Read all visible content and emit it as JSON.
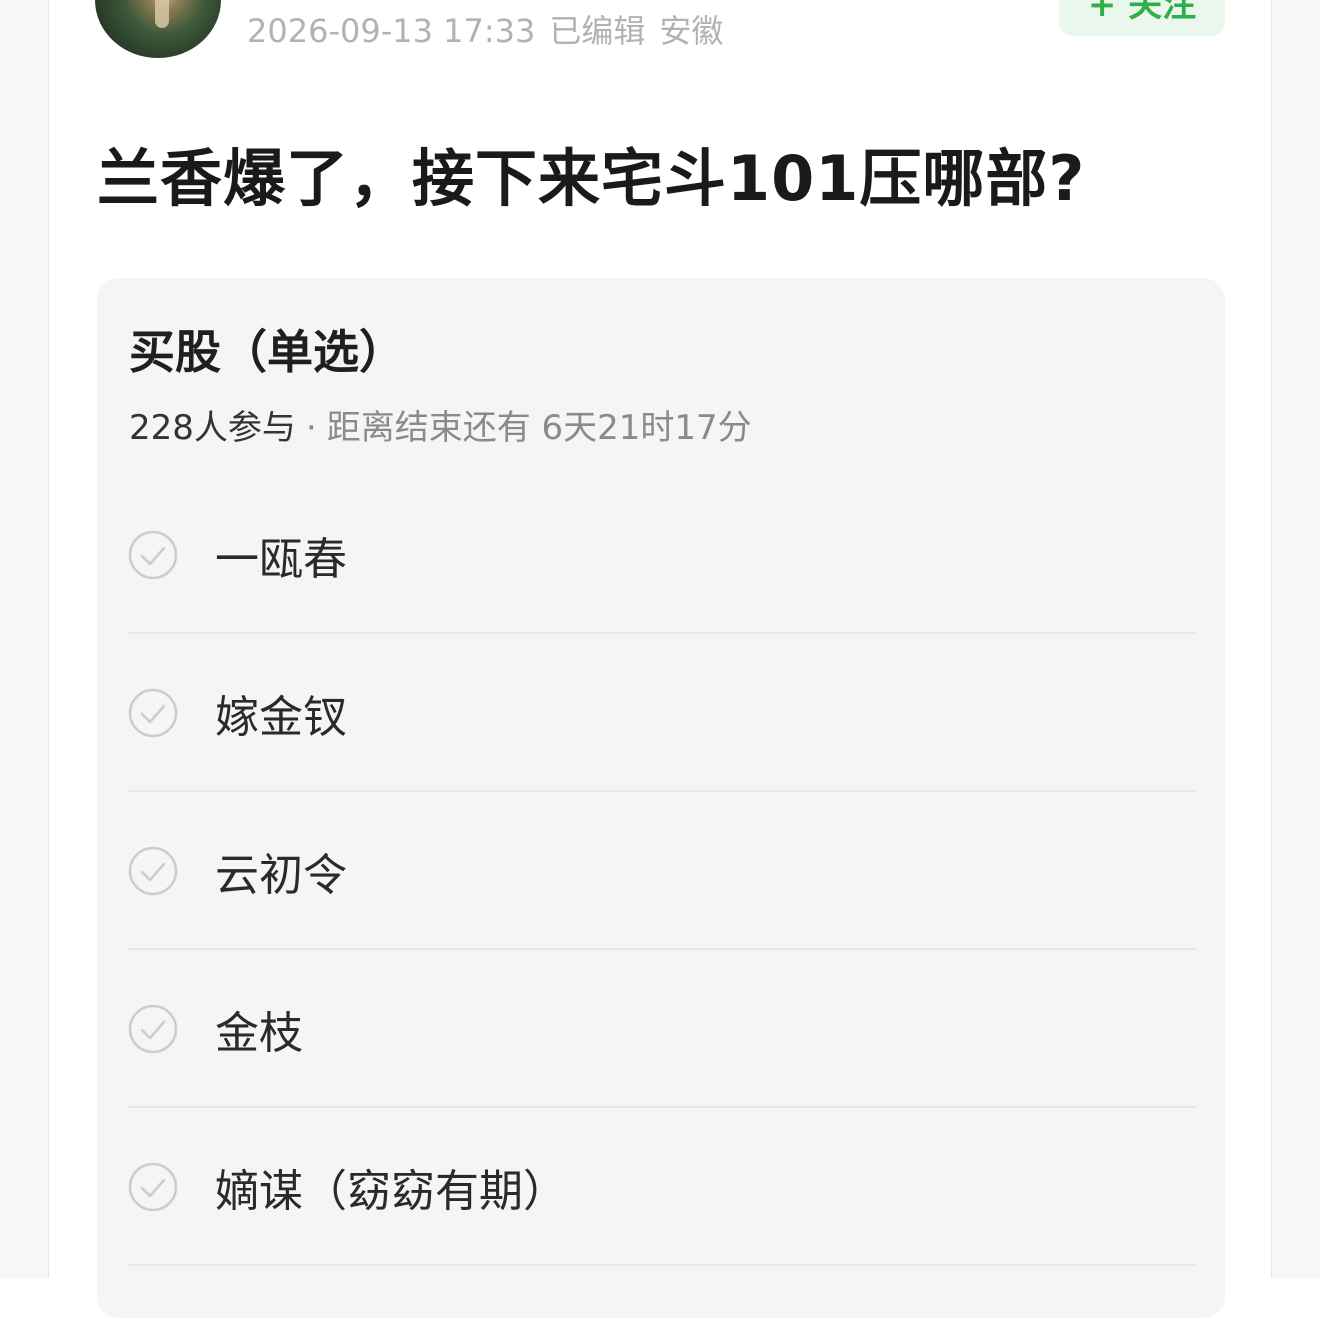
{
  "post": {
    "meta": {
      "timestamp": "2026-09-13 17:33",
      "edited": "已编辑",
      "location": "安徽"
    },
    "follow_label": "+ 关注",
    "title": "兰香爆了，接下来宅斗101压哪部?"
  },
  "poll": {
    "title": "买股（单选）",
    "participants": "228人参与",
    "separator": "·",
    "time_left": "距离结束还有 6天21时17分",
    "options": [
      {
        "label": "一瓯春"
      },
      {
        "label": "嫁金钗"
      },
      {
        "label": "云初令"
      },
      {
        "label": "金枝"
      },
      {
        "label": "嫡谋（窈窈有期）"
      }
    ],
    "colors": {
      "card_bg": "#f5f5f5",
      "follow_green": "#2fae4a",
      "check_gray": "#cccccc"
    },
    "icons": [
      "check-circle-icon"
    ]
  }
}
